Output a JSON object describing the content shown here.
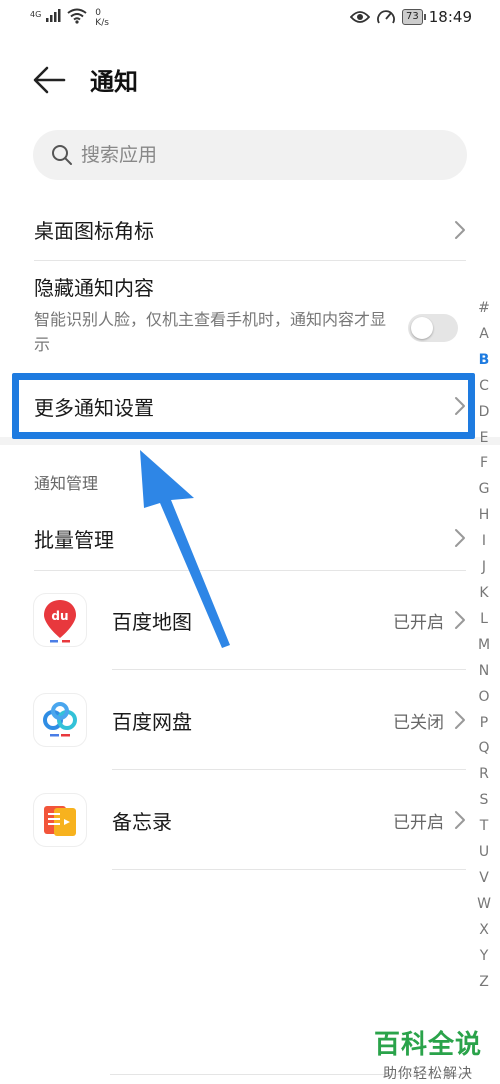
{
  "status_bar": {
    "signal_label": "4G",
    "net_speed_value": "0",
    "net_speed_unit": "K/s",
    "battery": "73",
    "time": "18:49"
  },
  "header": {
    "title": "通知"
  },
  "search": {
    "placeholder": "搜索应用"
  },
  "settings": {
    "desktop_badge": "桌面图标角标",
    "hide_content_title": "隐藏通知内容",
    "hide_content_desc": "智能识别人脸，仅机主查看手机时，通知内容才显示",
    "hide_content_toggle_on": false,
    "more_settings": "更多通知设置"
  },
  "management": {
    "section_label": "通知管理",
    "batch_manage": "批量管理"
  },
  "apps": [
    {
      "name": "百度地图",
      "status": "已开启",
      "icon": "baidu-map-icon"
    },
    {
      "name": "百度网盘",
      "status": "已关闭",
      "icon": "baidu-netdisk-icon"
    },
    {
      "name": "备忘录",
      "status": "已开启",
      "icon": "memo-icon"
    }
  ],
  "alpha_index": [
    "#",
    "A",
    "B",
    "C",
    "D",
    "E",
    "F",
    "G",
    "H",
    "I",
    "J",
    "K",
    "L",
    "M",
    "N",
    "O",
    "P",
    "Q",
    "R",
    "S",
    "T",
    "U",
    "V",
    "W",
    "X",
    "Y",
    "Z"
  ],
  "alpha_active": "B",
  "watermark": {
    "title": "百科全说",
    "subtitle": "助你轻松解决"
  },
  "colors": {
    "highlight": "#1e7be0",
    "watermark": "#2aa34a"
  }
}
